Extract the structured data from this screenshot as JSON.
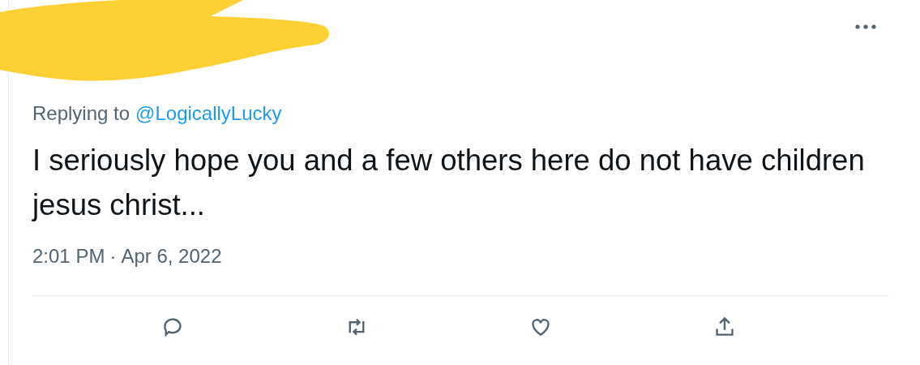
{
  "reply_context": {
    "prefix": "Replying to",
    "handle": "@LogicallyLucky"
  },
  "tweet_text": "I seriously hope you and a few others here do not have children jesus christ...",
  "timestamp": {
    "time": "2:01 PM",
    "separator": "·",
    "date": "Apr 6, 2022"
  },
  "actions": [
    {
      "kind": "reply"
    },
    {
      "kind": "retweet"
    },
    {
      "kind": "like"
    },
    {
      "kind": "share"
    }
  ]
}
